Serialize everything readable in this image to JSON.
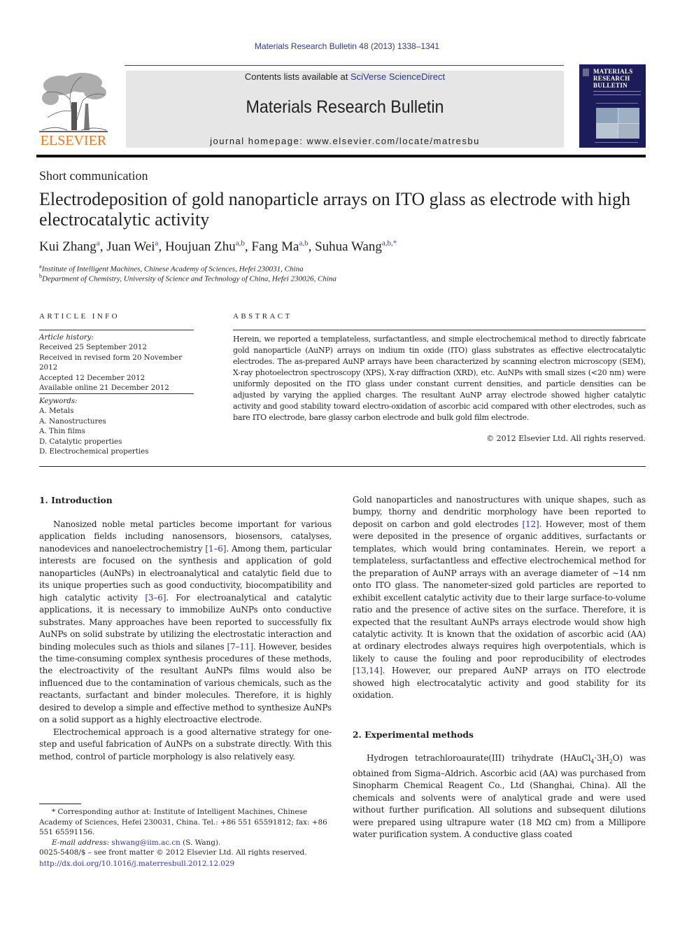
{
  "header": {
    "citation": "Materials Research Bulletin 48 (2013) 1338–1341",
    "contents_prefix": "Contents lists available at ",
    "contents_link": "SciVerse ScienceDirect",
    "journal_name": "Materials Research Bulletin",
    "homepage": "journal homepage: www.elsevier.com/locate/matresbu",
    "publisher_logo_text": "ELSEVIER",
    "cover_title_lines": [
      "MATERIALS",
      "RESEARCH",
      "BULLETIN"
    ],
    "colors": {
      "link": "#2a3896",
      "elsevier_orange": "#e87722",
      "cover_bg": "#1d1c5a",
      "banner_bg": "#e6e6e6"
    }
  },
  "article": {
    "type": "Short communication",
    "title": "Electrodeposition of gold nanoparticle arrays on ITO glass as electrode with high electrocatalytic activity",
    "authors": [
      {
        "name": "Kui Zhang",
        "sup": "a",
        "sep": ", "
      },
      {
        "name": "Juan Wei",
        "sup": "a",
        "sep": ", "
      },
      {
        "name": "Houjuan Zhu",
        "sup": "a,b",
        "sep": ", "
      },
      {
        "name": "Fang Ma",
        "sup": "a,b",
        "sep": ", "
      },
      {
        "name": "Suhua Wang",
        "sup": "a,b,*",
        "sep": ""
      }
    ],
    "affiliations": [
      {
        "key": "a",
        "text": "Institute of Intelligent Machines, Chinese Academy of Sciences, Hefei 230031, China"
      },
      {
        "key": "b",
        "text": "Department of Chemistry, University of Science and Technology of China, Hefei 230026, China"
      }
    ]
  },
  "article_info": {
    "label": "ARTICLE INFO",
    "history_label": "Article history:",
    "history": [
      "Received 25 September 2012",
      "Received in revised form 20 November 2012",
      "Accepted 12 December 2012",
      "Available online 21 December 2012"
    ],
    "keywords_label": "Keywords:",
    "keywords": [
      "A. Metals",
      "A. Nanostructures",
      "A. Thin films",
      "D. Catalytic properties",
      "D. Electrochemical properties"
    ]
  },
  "abstract": {
    "label": "ABSTRACT",
    "text": "Herein, we reported a templateless, surfactantless, and simple electrochemical method to directly fabricate gold nanoparticle (AuNP) arrays on indium tin oxide (ITO) glass substrates as effective electrocatalytic electrodes. The as-prepared AuNP arrays have been characterized by scanning electron microscopy (SEM), X-ray photoelectron spectroscopy (XPS), X-ray diffraction (XRD), etc. AuNPs with small sizes (<20 nm) were uniformly deposited on the ITO glass under constant current densities, and particle densities can be adjusted by varying the applied charges. The resultant AuNP array electrode showed higher catalytic activity and good stability toward electro-oxidation of ascorbic acid compared with other electrodes, such as bare ITO electrode, bare glassy carbon electrode and bulk gold film electrode.",
    "copyright": "© 2012 Elsevier Ltd. All rights reserved."
  },
  "sections": {
    "intro_heading": "1.  Introduction",
    "intro_p1": [
      {
        "t": "Nanosized noble metal particles become important for various application fields including nanosensors, biosensors, catalyses, nanodevices and nanoelectrochemistry "
      },
      {
        "ref": "[1–6]"
      },
      {
        "t": ". Among them, particular interests are focused on the synthesis and application of gold nanoparticles (AuNPs) in electroanalytical and catalytic field due to its unique properties such as good conductivity, biocompatibility and high catalytic activity "
      },
      {
        "ref": "[3–6]"
      },
      {
        "t": ". For electroanalytical and catalytic applications, it is necessary to immobilize AuNPs onto conductive substrates. Many approaches have been reported to successfully fix AuNPs on solid substrate by utilizing the electrostatic interaction and binding molecules such as thiols and silanes "
      },
      {
        "ref": "[7–11]"
      },
      {
        "t": ". However, besides the time-consuming complex synthesis procedures of these methods, the electroactivity of the resultant AuNPs films would also be influenced due to the contamination of various chemicals, such as the reactants, surfactant and binder molecules. Therefore, it is highly desired to develop a simple and effective method to synthesize AuNPs on a solid support as a highly electroactive electrode."
      }
    ],
    "intro_p2": "Electrochemical approach is a good alternative strategy for one-step and useful fabrication of AuNPs on a substrate directly. With this method, control of particle morphology is also relatively easy.",
    "intro_p3": [
      {
        "t": "Gold nanoparticles and nanostructures with unique shapes, such as bumpy, thorny and dendritic morphology have been reported to deposit on carbon and gold electrodes "
      },
      {
        "ref": "[12]"
      },
      {
        "t": ". However, most of them were deposited in the presence of organic additives, surfactants or templates, which would bring contaminates. Herein, we report a templateless, surfactantless and effective electrochemical method for the preparation of AuNP arrays with an average diameter of ∼14 nm onto ITO glass. The nanometer-sized gold particles are reported to exhibit excellent catalytic activity due to their large surface-to-volume ratio and the presence of active sites on the surface. Therefore, it is expected that the resultant AuNPs arrays electrode would show high catalytic activity. It is known that the oxidation of ascorbic acid (AA) at ordinary electrodes always requires high overpotentials, which is likely to cause the fouling and poor reproducibility of electrodes "
      },
      {
        "ref": "[13,14]"
      },
      {
        "t": ". However, our prepared AuNP arrays on ITO electrode showed high electrocatalytic activity and good stability for its oxidation."
      }
    ],
    "methods_heading": "2.  Experimental methods",
    "methods_p1_a": "Hydrogen tetrachloroaurate(III) trihydrate (HAuCl",
    "methods_p1_sub1": "4",
    "methods_p1_b": "·3H",
    "methods_p1_sub2": "2",
    "methods_p1_c": "O) was obtained from Sigma–Aldrich. Ascorbic acid (AA) was purchased from Sinopharm Chemical Reagent Co., Ltd (Shanghai, China). All the chemicals and solvents were of analytical grade and were used without further purification. All solutions and subsequent dilutions were prepared using ultrapure water (18 MΩ cm) from a Millipore water purification system. A conductive glass coated"
  },
  "footnote": {
    "corresponding": "* Corresponding author at: Institute of Intelligent Machines, Chinese Academy of Sciences, Hefei 230031, China. Tel.: +86 551 65591812; fax: +86 551 65591156.",
    "email_label": "E-mail address: ",
    "email": "shwang@iim.ac.cn",
    "email_suffix": " (S. Wang).",
    "front_matter": "0025-5408/$ – see front matter © 2012 Elsevier Ltd. All rights reserved.",
    "doi": "http://dx.doi.org/10.1016/j.materresbull.2012.12.029"
  }
}
